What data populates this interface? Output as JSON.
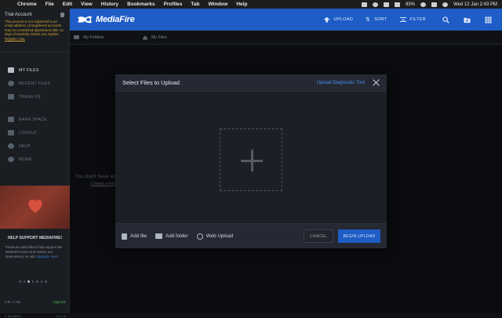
{
  "menubar": {
    "app": "Chrome",
    "items": [
      "File",
      "Edit",
      "View",
      "History",
      "Bookmarks",
      "Profiles",
      "Tab",
      "Window",
      "Help"
    ],
    "battery": "83%",
    "datetime": "Wed 12 Jan  2:43 PM"
  },
  "sidebar": {
    "trial_title": "Trial Account",
    "trial_message": "This account is not registered to an email address. Unregistered accounts may be considered abandoned after 14 days of inactivity unless you register.",
    "register_link": "Register now.",
    "nav": {
      "my_files": "MY FILES",
      "recent_files": "RECENT FILES",
      "trash": "TRASH (0)",
      "earn_space": "EARN SPACE",
      "logout": "LOGOUT",
      "help": "HELP",
      "more": "MORE"
    },
    "help_support_title": "HELP SUPPORT MEDIAFIRE!",
    "help_support_text": "Premium subscribers help support the MediaFire team and reduce our dependency on ads.",
    "upgrade_link": "Upgrade now!",
    "storage_used": "0 B / 1 GB",
    "storage_action": "Upgrade",
    "copyright": "© MediaFire",
    "version": "v4.1.11"
  },
  "topbar": {
    "logo_text": "MediaFire",
    "upload": "UPLOAD",
    "sort": "SORT",
    "filter": "FILTER"
  },
  "crumbs": {
    "my_folders": "My Folders",
    "my_files": "My Files"
  },
  "empty_state": {
    "message": "You don't have an",
    "create_link": "Create a folder"
  },
  "modal": {
    "title": "Select Files to Upload",
    "diagnostic_link": "Upload Diagnostic Tool",
    "add_file": "Add file",
    "add_folder": "Add folder",
    "web_upload": "Web Upload",
    "cancel": "CANCEL",
    "begin_upload": "BEGIN UPLOAD"
  },
  "colors": {
    "brand_blue": "#1e5cc6",
    "link_blue": "#4c8ff0",
    "trial_warning": "#d6a431",
    "background": "#0f1114"
  }
}
